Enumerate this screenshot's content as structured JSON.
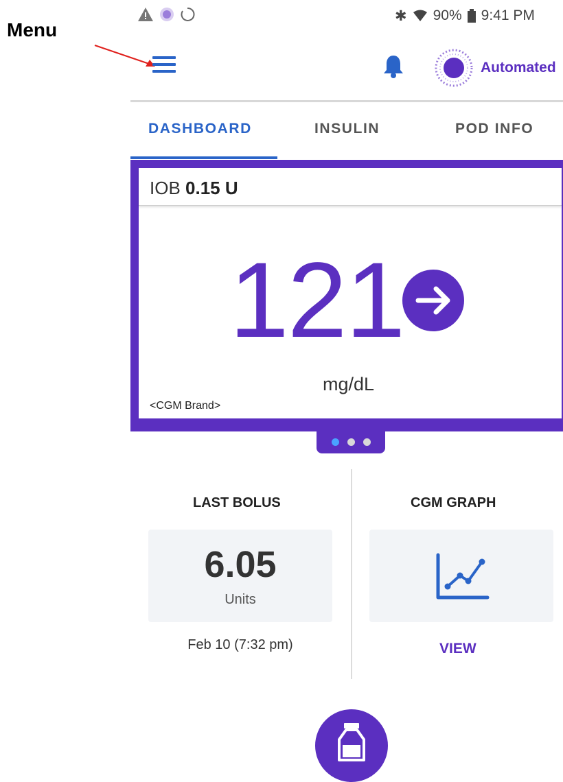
{
  "annotation": {
    "label": "Menu"
  },
  "status_bar": {
    "icons_left": [
      "warning-triangle-icon",
      "purple-dot-icon",
      "sync-circle-icon"
    ],
    "icons_right": [
      "bluetooth-icon",
      "wifi-icon",
      "battery-icon"
    ],
    "battery": "90%",
    "time": "9:41 PM"
  },
  "header": {
    "menu_icon": "hamburger-icon",
    "notification_icon": "bell-icon",
    "mode": "Automated"
  },
  "tabs": [
    {
      "label": "DASHBOARD",
      "active": true
    },
    {
      "label": "INSULIN",
      "active": false
    },
    {
      "label": "POD INFO",
      "active": false
    }
  ],
  "glucose_card": {
    "iob_label": "IOB",
    "iob_value": "0.15 U",
    "glucose": "121",
    "trend": "steady-right-arrow",
    "units": "mg/dL",
    "cgm_brand": "<CGM Brand>",
    "page_count": 3,
    "active_page": 1
  },
  "last_bolus": {
    "title": "LAST BOLUS",
    "value": "6.05",
    "units": "Units",
    "date": "Feb 10 (7:32 pm)"
  },
  "cgm_graph": {
    "title": "CGM GRAPH",
    "icon": "line-chart-icon",
    "link": "VIEW"
  },
  "bolus_button": {
    "icon": "insulin-vial-icon"
  },
  "colors": {
    "primary_purple": "#5b2fc0",
    "accent_blue": "#2a64c8",
    "annotation_red": "#e0201c"
  }
}
